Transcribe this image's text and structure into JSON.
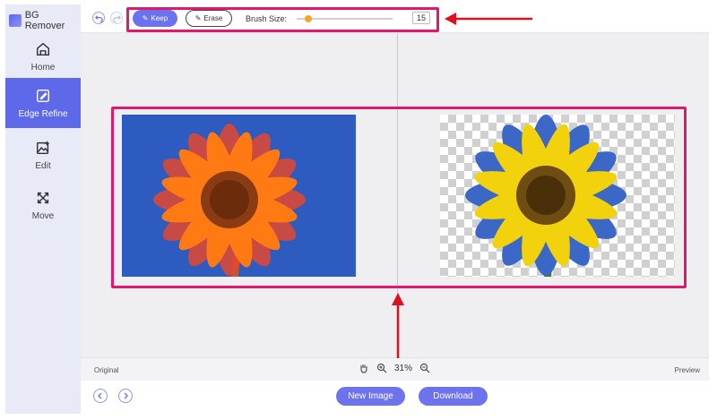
{
  "app": {
    "title": "BG Remover"
  },
  "sidebar": {
    "items": [
      {
        "label": "Home",
        "icon": "home-icon"
      },
      {
        "label": "Edge Refine",
        "icon": "edge-refine-icon",
        "active": true
      },
      {
        "label": "Edit",
        "icon": "image-edit-icon"
      },
      {
        "label": "Move",
        "icon": "move-icon"
      }
    ]
  },
  "toolbar": {
    "undo_icon": "undo-icon",
    "redo_icon": "redo-icon",
    "keep_label": "Keep",
    "erase_label": "Erase",
    "brush_size_label": "Brush Size:",
    "brush_size_value": "15",
    "brush_size_fraction": 0.12
  },
  "status": {
    "left_label": "Original",
    "right_label": "Preview",
    "zoom": "31%"
  },
  "footer": {
    "new_image_label": "New Image",
    "download_label": "Download"
  },
  "colors": {
    "accent": "#5d69e8",
    "highlight": "#e0186e",
    "original_bg": "#2d5bbf"
  }
}
